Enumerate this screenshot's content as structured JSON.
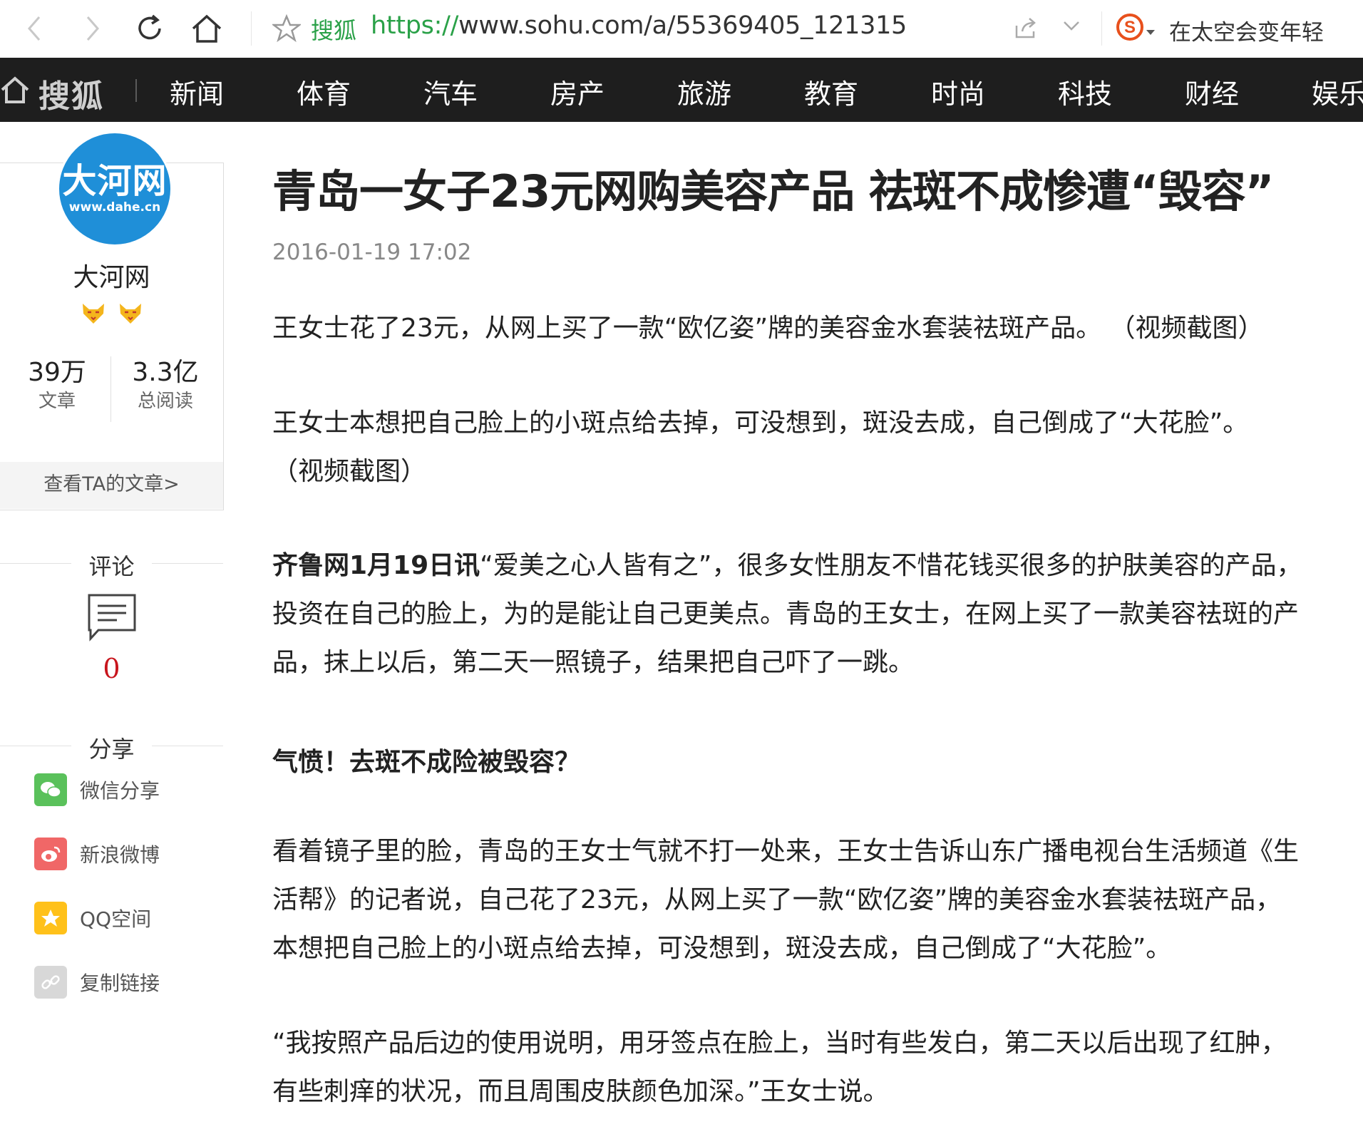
{
  "browser": {
    "site_name": "搜狐",
    "url_scheme": "https://",
    "url_rest": "www.sohu.com/a/55369405_121315",
    "hot_search": "在太空会变年轻"
  },
  "navbar": {
    "logo": "搜狐",
    "items": [
      "新闻",
      "体育",
      "汽车",
      "房产",
      "旅游",
      "教育",
      "时尚",
      "科技",
      "财经",
      "娱乐"
    ]
  },
  "author": {
    "avatar_text": "大河网",
    "avatar_domain": "www.dahe.cn",
    "name": "大河网",
    "articles_count": "39万",
    "articles_label": "文章",
    "reads_count": "3.3亿",
    "reads_label": "总阅读",
    "view_articles": "查看TA的文章>"
  },
  "comments": {
    "heading": "评论",
    "count": "0"
  },
  "share": {
    "heading": "分享",
    "items": [
      {
        "label": "微信分享",
        "icon": "wechat-icon",
        "color": "#5ac15b"
      },
      {
        "label": "新浪微博",
        "icon": "weibo-icon",
        "color": "#f06767"
      },
      {
        "label": "QQ空间",
        "icon": "qzone-icon",
        "color": "#ffc11a"
      },
      {
        "label": "复制链接",
        "icon": "link-icon",
        "color": "#d8d8d8"
      }
    ]
  },
  "article": {
    "title": "青岛一女子23元网购美容产品 祛斑不成惨遭“毁容”",
    "date": "2016-01-19 17:02",
    "p1": "王女士花了23元，从网上买了一款“欧亿姿”牌的美容金水套装祛斑产品。 （视频截图）",
    "p2": "王女士本想把自己脸上的小斑点给去掉，可没想到，斑没去成，自己倒成了“大花脸”。 （视频截图）",
    "p3_lead": "齐鲁网1月19日讯",
    "p3": "“爱美之心人皆有之”，很多女性朋友不惜花钱买很多的护肤美容的产品，投资在自己的脸上，为的是能让自己更美点。青岛的王女士，在网上买了一款美容祛斑的产品，抹上以后，第二天一照镜子，结果把自己吓了一跳。",
    "subheading": "气愤！去斑不成险被毁容？",
    "p4": "看着镜子里的脸，青岛的王女士气就不打一处来，王女士告诉山东广播电视台生活频道《生活帮》的记者说，自己花了23元，从网上买了一款“欧亿姿”牌的美容金水套装祛斑产品，本想把自己脸上的小斑点给去掉，可没想到，斑没去成，自己倒成了“大花脸”。",
    "p5": "“我按照产品后边的使用说明，用牙签点在脸上，当时有些发白，第二天以后出现了红肿，有些刺痒的状况，而且周围皮肤颜色加深。”王女士说。"
  }
}
